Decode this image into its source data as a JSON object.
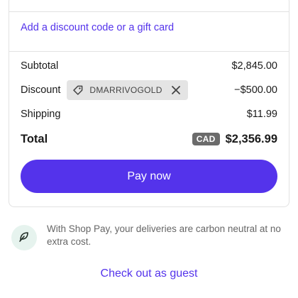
{
  "discount": {
    "link_label": "Add a discount code or a gift card"
  },
  "summary": {
    "subtotal_label": "Subtotal",
    "subtotal_value": "$2,845.00",
    "discount_label": "Discount",
    "discount_code": "DMARRIVOGOLD",
    "discount_value": "−$500.00",
    "shipping_label": "Shipping",
    "shipping_value": "$11.99",
    "total_label": "Total",
    "currency": "CAD",
    "total_value": "$2,356.99"
  },
  "pay_button": {
    "label": "Pay now"
  },
  "shop_pay": {
    "note": "With Shop Pay, your deliveries are carbon neutral at no extra cost."
  },
  "guest": {
    "link_label": "Check out as guest"
  },
  "colors": {
    "accent": "#5433eb",
    "badge": "#6b6b6b",
    "chip": "#e4e4e4",
    "leaf_bg": "#e6f3ee"
  },
  "icons": {
    "tag": "tag-icon",
    "close": "close-icon",
    "leaf": "leaf-icon"
  }
}
